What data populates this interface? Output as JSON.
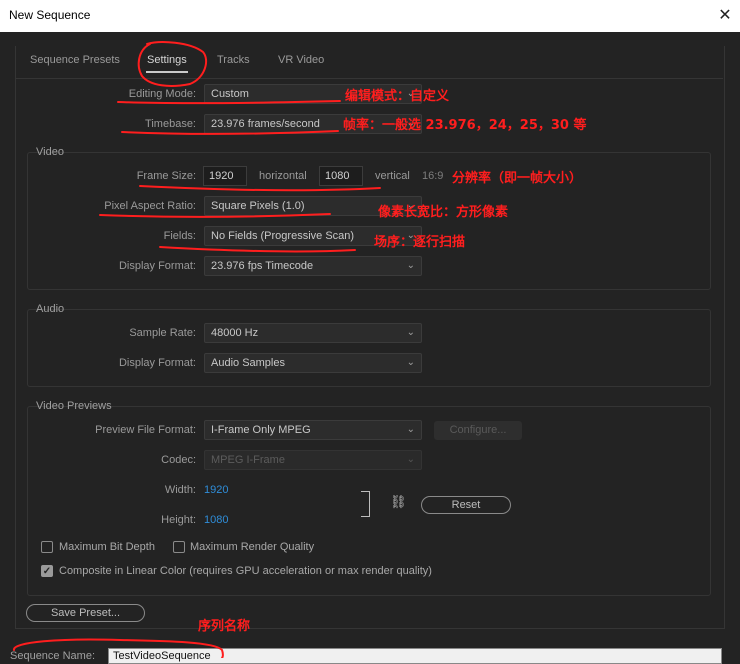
{
  "window": {
    "title": "New Sequence"
  },
  "tabs": [
    {
      "label": "Sequence Presets"
    },
    {
      "label": "Settings"
    },
    {
      "label": "Tracks"
    },
    {
      "label": "VR Video"
    }
  ],
  "general": {
    "editing_mode": {
      "label": "Editing Mode:",
      "value": "Custom"
    },
    "timebase": {
      "label": "Timebase:",
      "value": "23.976  frames/second"
    }
  },
  "video": {
    "title": "Video",
    "frame_size": {
      "label": "Frame Size:",
      "width": "1920",
      "horizontal": "horizontal",
      "height": "1080",
      "vertical": "vertical",
      "aspect": "16:9"
    },
    "pixel_aspect": {
      "label": "Pixel Aspect Ratio:",
      "value": "Square Pixels (1.0)"
    },
    "fields": {
      "label": "Fields:",
      "value": "No Fields (Progressive Scan)"
    },
    "display_format": {
      "label": "Display Format:",
      "value": "23.976 fps Timecode"
    }
  },
  "audio": {
    "title": "Audio",
    "sample_rate": {
      "label": "Sample Rate:",
      "value": "48000 Hz"
    },
    "display_format": {
      "label": "Display Format:",
      "value": "Audio Samples"
    }
  },
  "previews": {
    "title": "Video Previews",
    "file_format": {
      "label": "Preview File Format:",
      "value": "I-Frame Only MPEG"
    },
    "configure": "Configure...",
    "codec": {
      "label": "Codec:",
      "value": "MPEG I-Frame"
    },
    "width": {
      "label": "Width:",
      "value": "1920"
    },
    "height": {
      "label": "Height:",
      "value": "1080"
    },
    "reset": "Reset"
  },
  "options": {
    "max_bit_depth": {
      "label": "Maximum Bit Depth",
      "checked": false
    },
    "max_render_quality": {
      "label": "Maximum Render Quality",
      "checked": false
    },
    "linear_color": {
      "label": "Composite in Linear Color (requires GPU acceleration or max render quality)",
      "checked": true
    }
  },
  "save_preset": "Save Preset...",
  "sequence_name": {
    "label": "Sequence Name:",
    "value": "TestVideoSequence"
  },
  "annotations": {
    "editing_mode": "编辑模式：自定义",
    "timebase": "帧率：一般选 23.976，24，25，30 等",
    "frame_size": "分辨率（即一帧大小）",
    "pixel_aspect": "像素长宽比：方形像素",
    "fields": "场序：逐行扫描",
    "sequence_name": "序列名称",
    "color": "#ff1e1e"
  },
  "colors": {
    "background": "#232323",
    "accent_blue": "#2f8dd8",
    "annotation_red": "#ff1e1e"
  }
}
